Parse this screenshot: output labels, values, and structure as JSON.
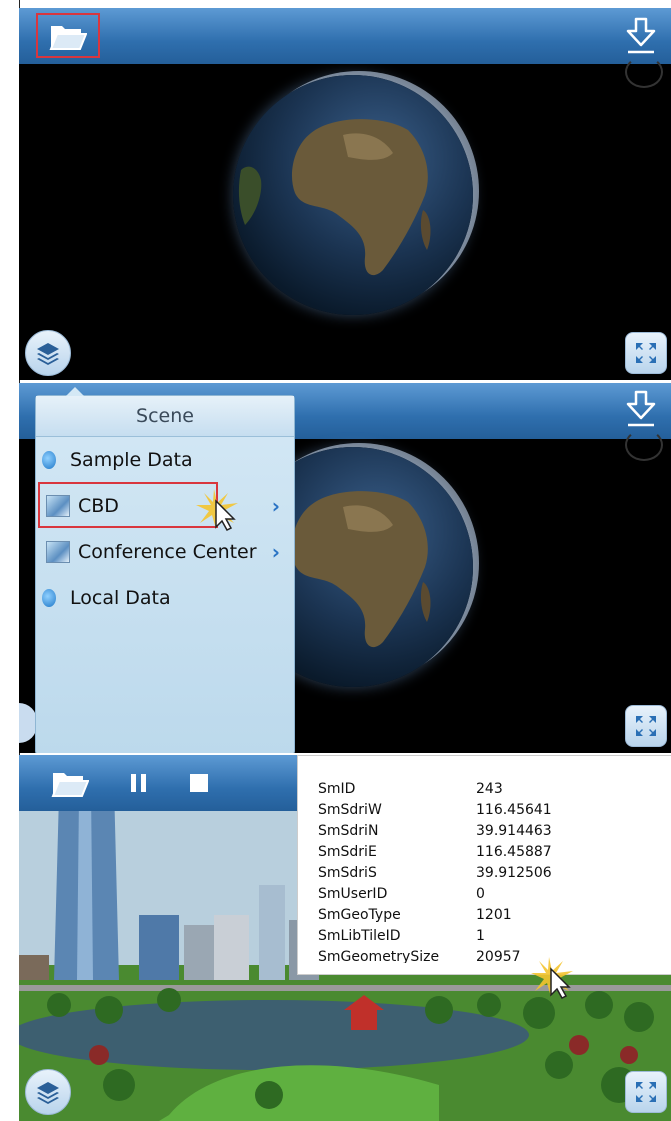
{
  "panel2": {
    "popup_title": "Scene",
    "tree": [
      {
        "label": "Sample Data",
        "type": "group"
      },
      {
        "label": "CBD",
        "type": "item",
        "highlighted": true
      },
      {
        "label": "Conference Center",
        "type": "item"
      },
      {
        "label": "Local Data",
        "type": "group"
      }
    ]
  },
  "panel3": {
    "attributes": [
      {
        "key": "SmID",
        "value": "243"
      },
      {
        "key": "SmSdriW",
        "value": "116.45641"
      },
      {
        "key": "SmSdriN",
        "value": "39.914463"
      },
      {
        "key": "SmSdriE",
        "value": "116.45887"
      },
      {
        "key": "SmSdriS",
        "value": "39.912506"
      },
      {
        "key": "SmUserID",
        "value": "0"
      },
      {
        "key": "SmGeoType",
        "value": "1201"
      },
      {
        "key": "SmLibTileID",
        "value": "1"
      },
      {
        "key": "SmGeometrySize",
        "value": "20957"
      }
    ]
  },
  "icons": {
    "open": "folder-open-icon",
    "download": "download-icon",
    "layers": "layers-icon",
    "fullscreen": "fullscreen-icon",
    "pause": "pause-icon",
    "stop": "stop-icon"
  },
  "colors": {
    "toolbar": "#2f6fae",
    "highlight_box": "#d9363e",
    "chevron": "#2a73c4"
  }
}
